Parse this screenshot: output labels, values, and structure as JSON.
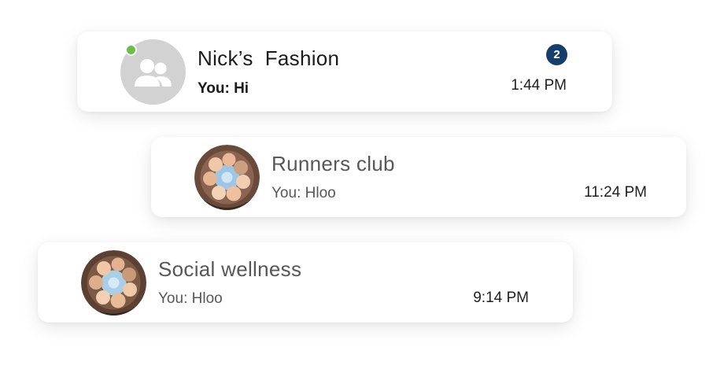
{
  "conversations": [
    {
      "title": "Nick’s  Fashion",
      "preview": "You: Hi",
      "time": "1:44 PM",
      "unread_count": "2",
      "online": true,
      "avatar": "group-placeholder-icon"
    },
    {
      "title": "Runners club",
      "preview": "You: Hloo",
      "time": "11:24 PM",
      "avatar": "group-photo"
    },
    {
      "title": "Social wellness",
      "preview": "You: Hloo",
      "time": "9:14 PM",
      "avatar": "group-photo"
    }
  ],
  "colors": {
    "online": "#6bc048",
    "badge": "#163e6b",
    "placeholder_avatar": "#d2d2d2"
  }
}
